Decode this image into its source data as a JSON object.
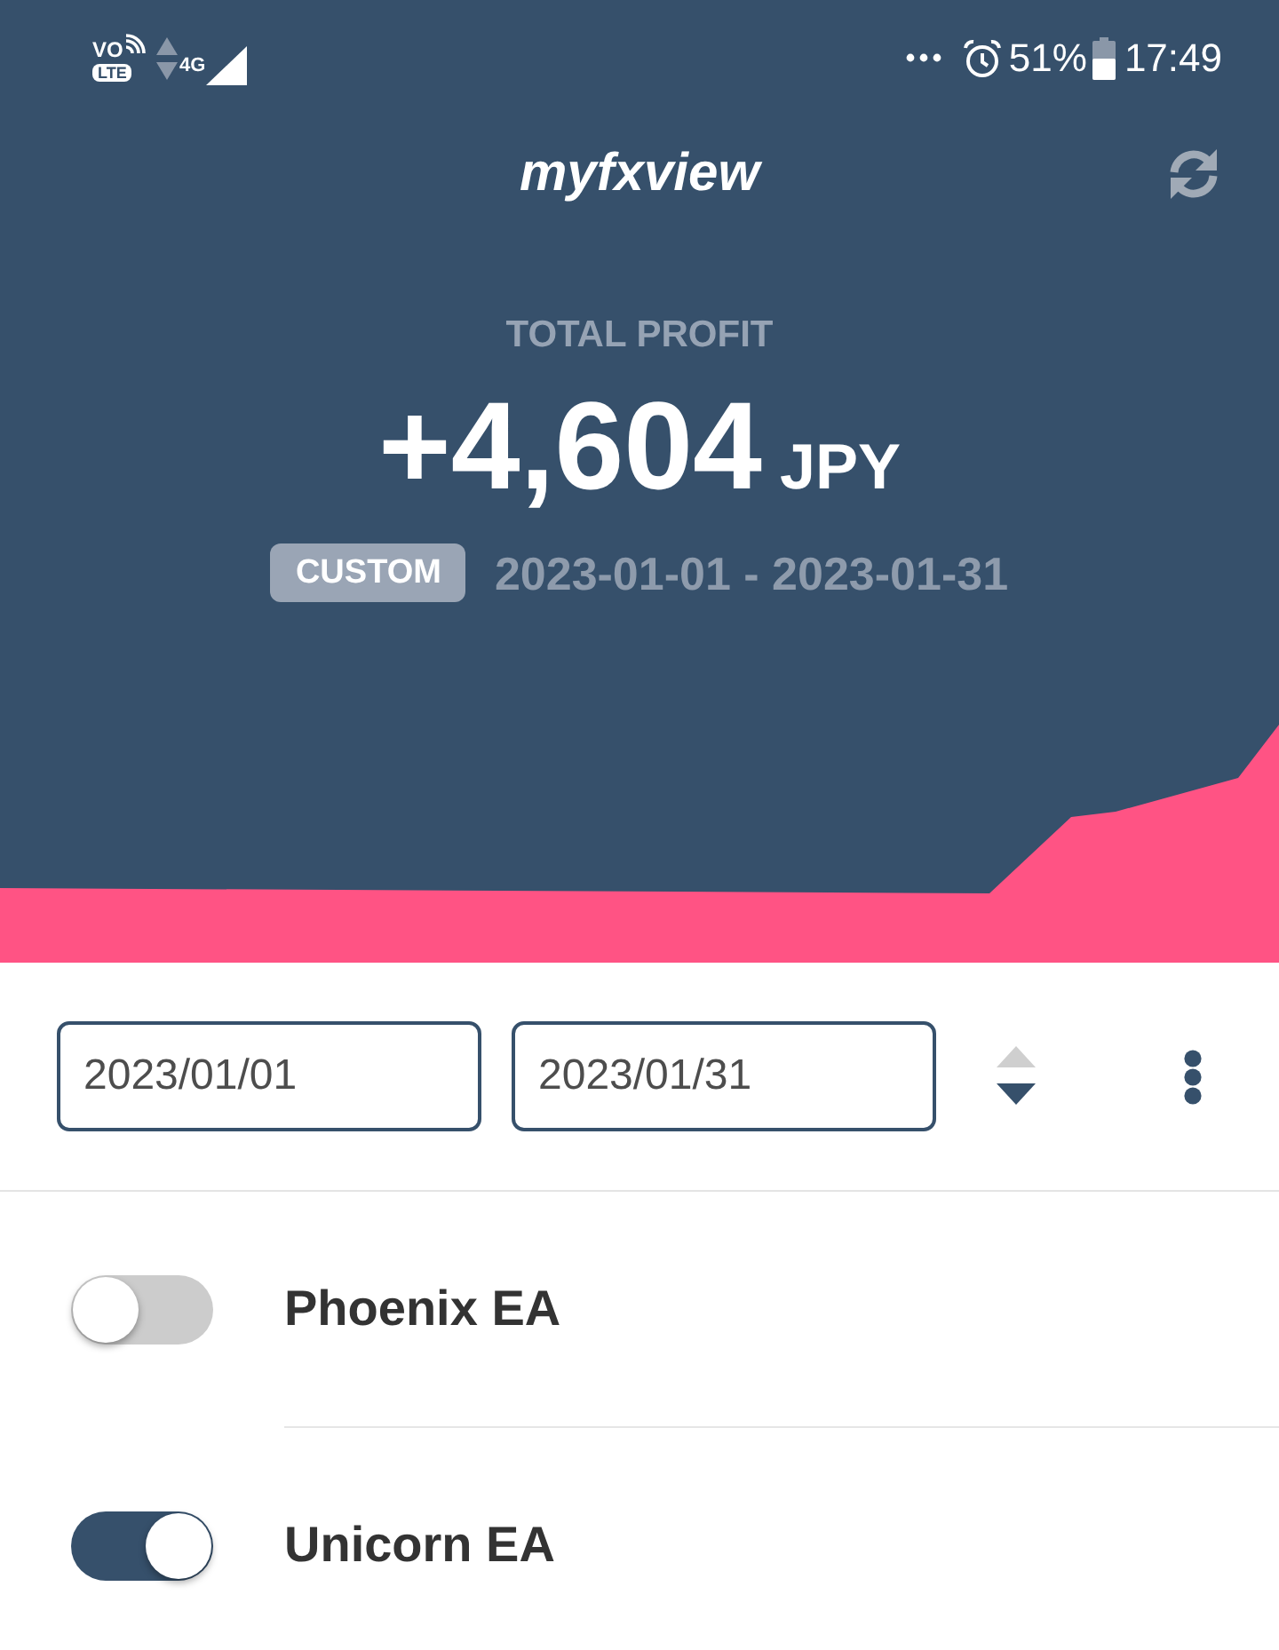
{
  "status_bar": {
    "volte": "VO",
    "lte": "LTE",
    "network": "4G",
    "battery": "51%",
    "time": "17:49"
  },
  "header": {
    "title": "myfxview",
    "label": "TOTAL PROFIT",
    "amount": "+4,604",
    "currency": "JPY",
    "period_badge": "CUSTOM",
    "period_range": "2023-01-01 - 2023-01-31"
  },
  "date_filter": {
    "start_date": "2023/01/01",
    "end_date": "2023/01/31"
  },
  "eas": [
    {
      "name": "Phoenix EA",
      "on": false
    },
    {
      "name": "Unicorn EA",
      "on": true
    }
  ]
}
